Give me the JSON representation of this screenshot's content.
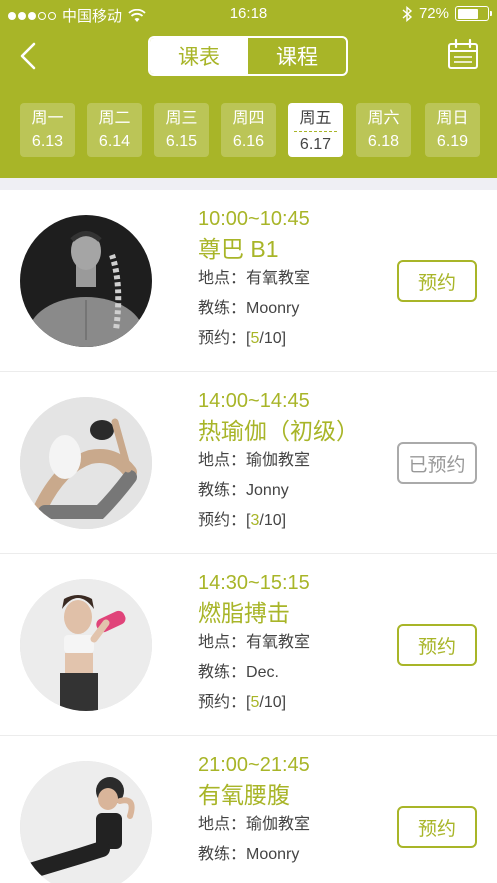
{
  "status": {
    "carrier": "中国移动",
    "time": "16:18",
    "battery": "72%",
    "battery_level": 0.72
  },
  "nav": {
    "tabs": [
      {
        "label": "课表",
        "active": true
      },
      {
        "label": "课程",
        "active": false
      }
    ],
    "back_icon": "chevron-left-icon",
    "calendar_icon": "calendar-icon"
  },
  "days": [
    {
      "weekday": "周一",
      "date": "6.13",
      "active": false
    },
    {
      "weekday": "周二",
      "date": "6.14",
      "active": false
    },
    {
      "weekday": "周三",
      "date": "6.15",
      "active": false
    },
    {
      "weekday": "周四",
      "date": "6.16",
      "active": false
    },
    {
      "weekday": "周五",
      "date": "6.17",
      "active": true
    },
    {
      "weekday": "周六",
      "date": "6.18",
      "active": false
    },
    {
      "weekday": "周日",
      "date": "6.19",
      "active": false
    }
  ],
  "labels": {
    "location": "地点：",
    "coach": "教练：",
    "booking": "预约：",
    "bracket_open": "[",
    "bracket_close": "]"
  },
  "classes": [
    {
      "time": "10:00~10:45",
      "name": "尊巴 B1",
      "location": "有氧教室",
      "coach": "Moonry",
      "booked": "5",
      "capacity": "/10",
      "button": "预约",
      "reserved": false
    },
    {
      "time": "14:00~14:45",
      "name": "热瑜伽（初级）",
      "location": "瑜伽教室",
      "coach": "Jonny",
      "booked": "3",
      "capacity": "/10",
      "button": "已预约",
      "reserved": true
    },
    {
      "time": "14:30~15:15",
      "name": "燃脂搏击",
      "location": "有氧教室",
      "coach": "Dec.",
      "booked": "5",
      "capacity": "/10",
      "button": "预约",
      "reserved": false
    },
    {
      "time": "21:00~21:45",
      "name": "有氧腰腹",
      "location": "瑜伽教室",
      "coach": "Moonry",
      "booked": "",
      "capacity": "",
      "button": "预约",
      "reserved": false
    }
  ],
  "colors": {
    "accent": "#a8b528",
    "reserved": "#999999"
  }
}
